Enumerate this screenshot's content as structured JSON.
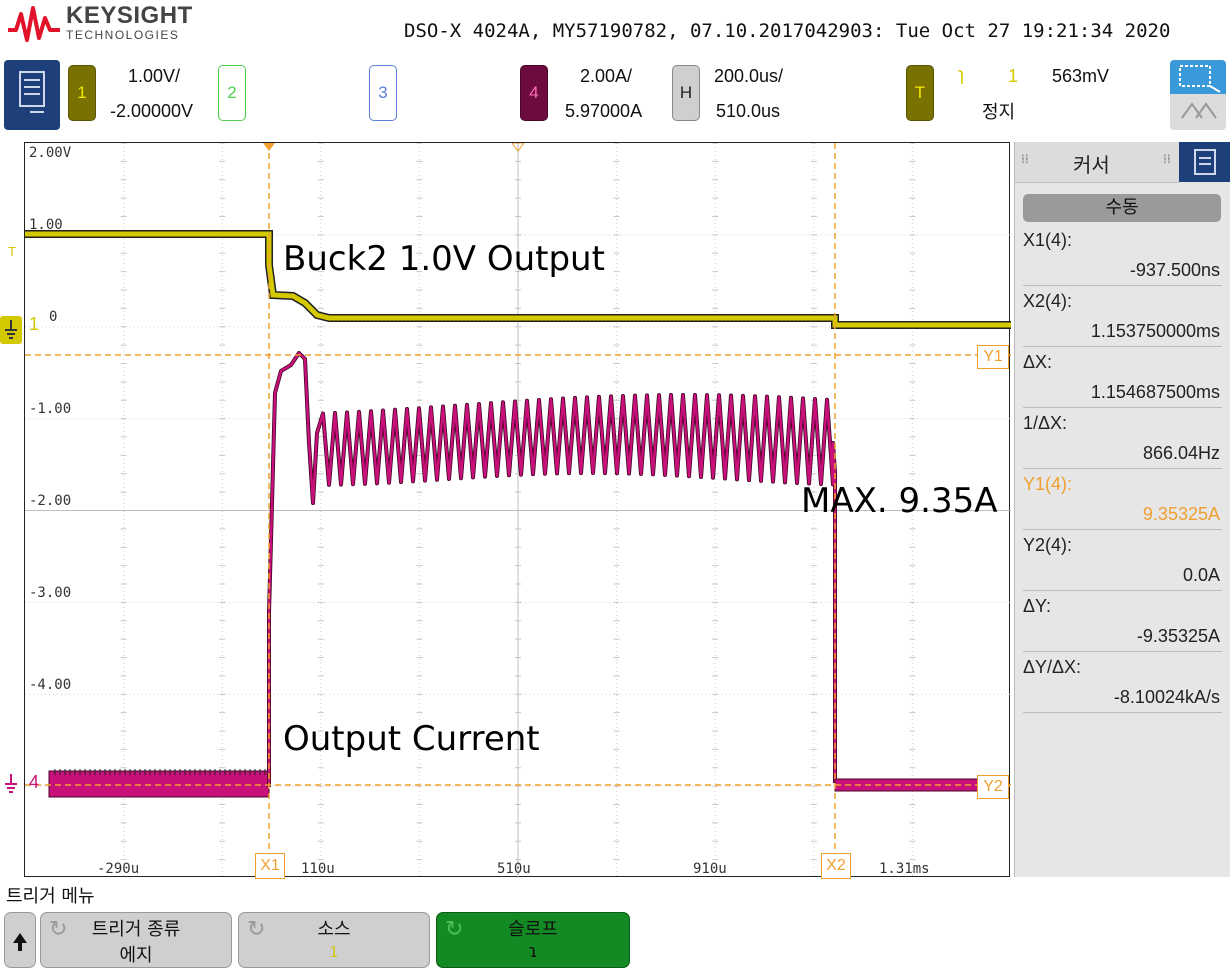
{
  "header": {
    "brand": "KEYSIGHT",
    "brand_sub": "TECHNOLOGIES",
    "scope_info": "DSO-X 4024A, MY57190782, 07.10.2017042903: Tue Oct 27 19:21:34 2020"
  },
  "channels": {
    "ch1": {
      "label": "1",
      "scale": "1.00V/",
      "offset": "-2.00000V",
      "color": "#d4c800"
    },
    "ch2": {
      "label": "2",
      "color": "#4cd14c"
    },
    "ch3": {
      "label": "3",
      "color": "#5b7fd6"
    },
    "ch4": {
      "label": "4",
      "scale": "2.00A/",
      "offset": "5.97000A",
      "color": "#c8107a"
    },
    "horizontal": {
      "label": "H",
      "scale": "200.0us/",
      "position": "510.0us"
    },
    "trigger": {
      "label": "T",
      "slope_glyph": "ɿ",
      "source": "1",
      "level": "563mV",
      "status": "정지"
    }
  },
  "graticule": {
    "y_labels": [
      "2.00V",
      "1.00",
      "0",
      "-1.00",
      "-2.00",
      "-3.00",
      "-4.00"
    ],
    "x_labels": [
      "-290u",
      "110u",
      "510u",
      "910u",
      "1.31ms"
    ],
    "marker_x1": "X1",
    "marker_x2": "X2",
    "marker_y1": "Y1",
    "marker_y2": "Y2",
    "ch1_ground": "1",
    "ch4_ground": "4",
    "trig_marker": "T"
  },
  "annotations": {
    "buck_label": "Buck2 1.0V Output",
    "current_label": "Output Current",
    "max_label": "MAX. 9.35A"
  },
  "cursor_panel": {
    "title": "커서",
    "mode_button": "수동",
    "measurements": [
      {
        "label": "X1(4):",
        "value": "-937.500ns",
        "highlight": false
      },
      {
        "label": "X2(4):",
        "value": "1.153750000ms",
        "highlight": false
      },
      {
        "label": "ΔX:",
        "value": "1.154687500ms",
        "highlight": false
      },
      {
        "label": "1/ΔX:",
        "value": "866.04Hz",
        "highlight": false
      },
      {
        "label": "Y1(4):",
        "value": "9.35325A",
        "highlight": true
      },
      {
        "label": "Y2(4):",
        "value": "0.0A",
        "highlight": false
      },
      {
        "label": "ΔY:",
        "value": "-9.35325A",
        "highlight": false
      },
      {
        "label": "ΔY/ΔX:",
        "value": "-8.10024kA/s",
        "highlight": false
      }
    ]
  },
  "softkeys": {
    "menu_title": "트리거 메뉴",
    "trigger_type_label": "트리거 종류",
    "trigger_type_value": "에지",
    "source_label": "소스",
    "source_value": "1",
    "slope_label": "슬로프",
    "slope_value": "ɿ"
  }
}
